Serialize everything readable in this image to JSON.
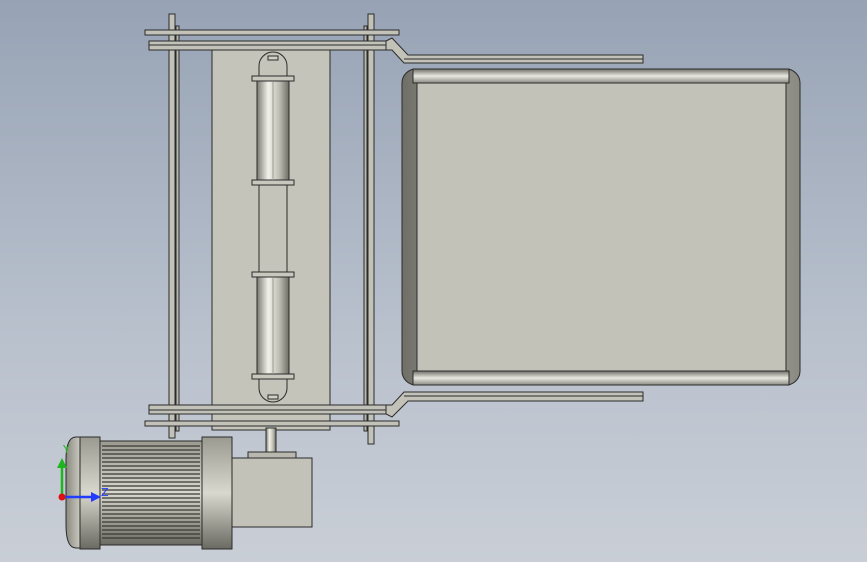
{
  "view": {
    "background_top": "#97a3b5",
    "background_bottom": "#c9ced6",
    "part_fill": "#c2c2b8",
    "part_edge": "#2b2b2b",
    "motor_dark": "#4a4a44"
  },
  "triad": {
    "y_label": "Y",
    "z_label": "Z",
    "y_color": "#1fb51f",
    "z_color": "#1f3cff",
    "x_color": "#e01010"
  }
}
